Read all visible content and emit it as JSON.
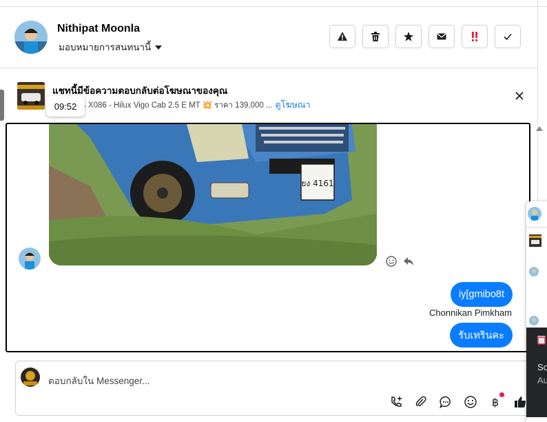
{
  "header": {
    "name": "Nithipat Moonla",
    "assign_label": "มอบหมายการสนทนานี้",
    "actions": [
      "warning-icon",
      "trash-icon",
      "star-icon",
      "mail-icon",
      "priority-icon",
      "check-icon"
    ]
  },
  "ad_banner": {
    "title": "แชทนี้มีข้อความตอบกลับต่อโฆษณาของคุณ",
    "snippet": "ภาพ!!! 🚙 X086 - Hilux Vigo Cab 2.5 E MT 💥 ราคา 139,000 ...",
    "link": "ดูโฆษณา",
    "tooltip_time": "09:52"
  },
  "conversation": {
    "plate_text": "ยง 4161",
    "messages": [
      {
        "text": "iy[gmibo8t"
      },
      {
        "text": "รับเทรินคะ"
      }
    ],
    "sender": "Chonnikan Pimkham"
  },
  "composer": {
    "placeholder": "ตอบกลับใน Messenger..."
  },
  "side_panel": {
    "dark_text_1": "So",
    "dark_text_2": "Au"
  },
  "colors": {
    "accent": "#0a7cff",
    "link": "#1877f2",
    "priority": "#e41e3f"
  }
}
